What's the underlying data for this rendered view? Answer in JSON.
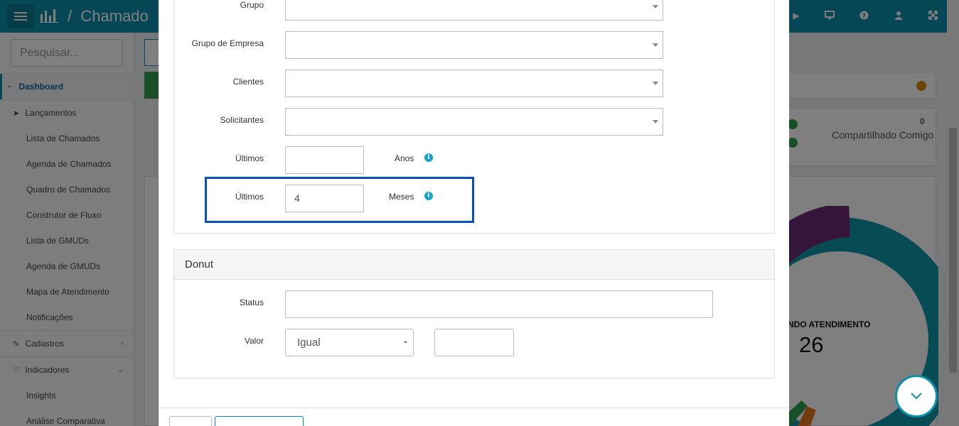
{
  "app": {
    "title": "Chamado",
    "separator": "/"
  },
  "sidebar": {
    "search_placeholder": "Pesquisar...",
    "items": [
      {
        "label": "Dashboard",
        "icon": "dashboard-icon"
      },
      {
        "label": "Lançamentos",
        "icon": "paper-plane-icon"
      },
      {
        "label": "Lista de Chamados"
      },
      {
        "label": "Agenda de Chamados"
      },
      {
        "label": "Quadro de Chamados"
      },
      {
        "label": "Construtor de Fluxo"
      },
      {
        "label": "Lista de GMUDs"
      },
      {
        "label": "Agenda de GMUDs"
      },
      {
        "label": "Mapa de Atendimento"
      },
      {
        "label": "Notificações"
      },
      {
        "label": "Cadastros",
        "icon": "edit-icon"
      },
      {
        "label": "Indicadores",
        "icon": "heart-icon"
      },
      {
        "label": "Insights"
      },
      {
        "label": "Análise Comparativa"
      }
    ]
  },
  "background": {
    "shared_count": "0",
    "shared_label": "Compartilhado Comigo",
    "donut_label": "NDO ATENDIMENTO",
    "donut_value": "26",
    "colors": {
      "teal": "#0e97aa",
      "purple": "#6b2a72",
      "green": "#2e9e4c",
      "orange": "#e87722"
    }
  },
  "modal": {
    "filters": {
      "grupo_label": "Grupo",
      "grupo_empresa_label": "Grupo de Empresa",
      "clientes_label": "Clientes",
      "solicitantes_label": "Solicitantes",
      "ultimos_anos_label": "Últimos",
      "ultimos_anos_value": "",
      "anos_unit": "Anos",
      "ultimos_meses_label": "Últimos",
      "ultimos_meses_value": "4",
      "meses_unit": "Meses"
    },
    "donut": {
      "heading": "Donut",
      "status_label": "Status",
      "status_value": "",
      "valor_label": "Valor",
      "valor_selected": "Igual",
      "valor_input": ""
    }
  },
  "theme": {
    "primary": "#0b8fa8",
    "highlight": "#0a4fb8",
    "info": "#17a2c8"
  }
}
